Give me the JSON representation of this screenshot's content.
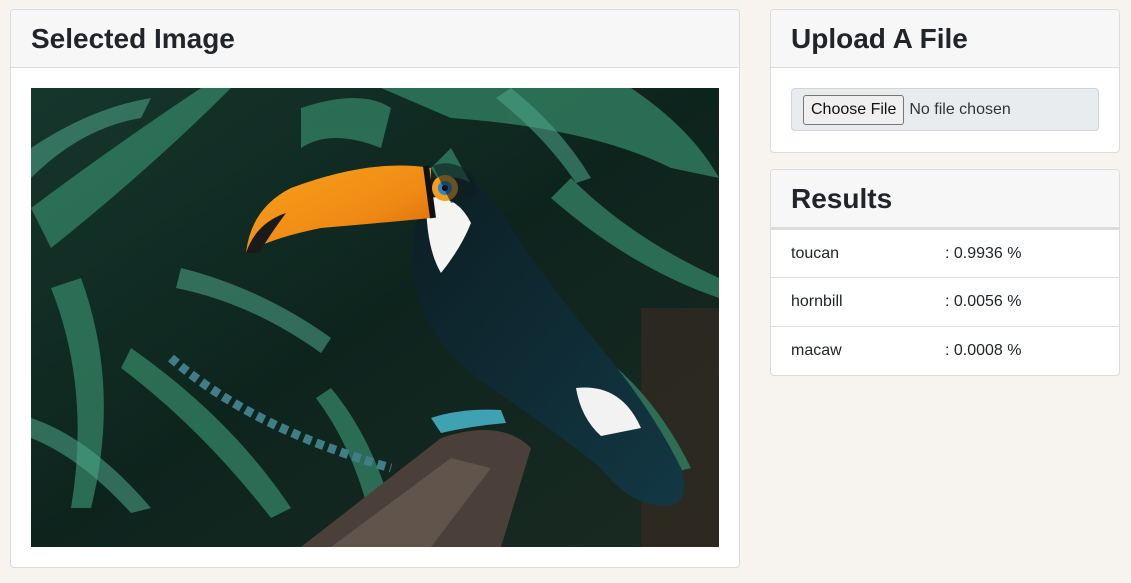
{
  "selected_image": {
    "title": "Selected Image",
    "image": "toucan-photo"
  },
  "upload": {
    "title": "Upload A File",
    "button_label": "Choose File",
    "status_text": "No file chosen"
  },
  "results": {
    "title": "Results",
    "items": [
      {
        "label": "toucan",
        "score": ": 0.9936 %"
      },
      {
        "label": "hornbill",
        "score": ": 0.0056 %"
      },
      {
        "label": "macaw",
        "score": ": 0.0008 %"
      }
    ]
  }
}
